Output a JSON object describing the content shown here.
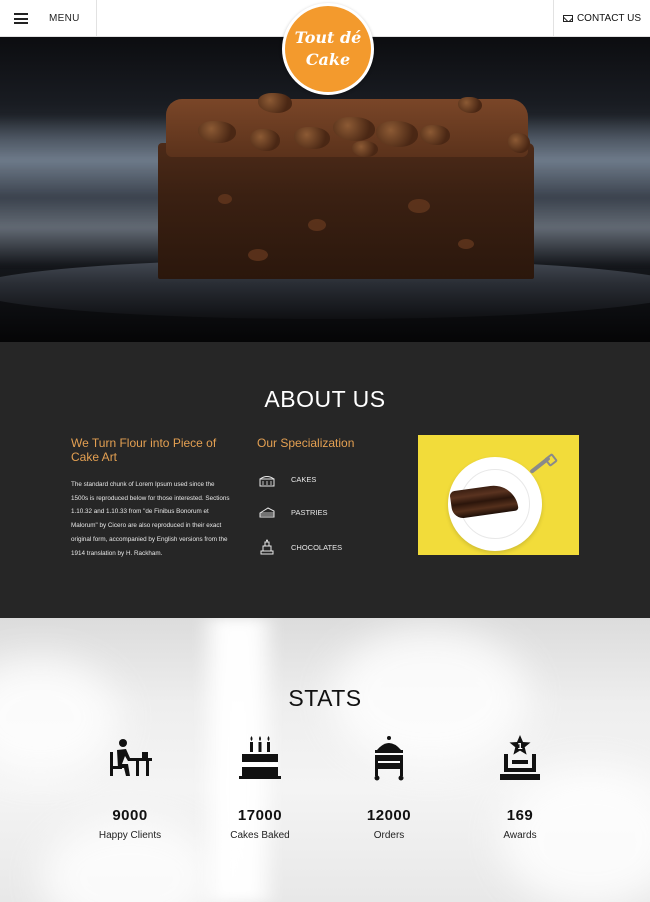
{
  "header": {
    "menu_label": "MENU",
    "contact_label": "CONTACT US",
    "logo_line1": "Tout dé",
    "logo_line2": "Cake",
    "logo_color": "#f39a2d"
  },
  "hero": {
    "image": "chocolate-walnut-brownie"
  },
  "about": {
    "title": "ABOUT US",
    "heading_left": "We Turn Flour into Piece of Cake Art",
    "text": "The standard chunk of Lorem Ipsum used since the 1500s is reproduced below for those interested. Sections 1.10.32 and 1.10.33 from \"de Finibus Bonorum et Malorum\" by Cicero are also reproduced in their exact original form, accompanied by English versions from the 1914 translation by H. Rackham.",
    "heading_middle": "Our Specialization",
    "specializations": [
      {
        "icon": "cake-icon",
        "label": "CAKES"
      },
      {
        "icon": "pastry-icon",
        "label": "PASTRIES"
      },
      {
        "icon": "chocolate-icon",
        "label": "CHOCOLATES"
      }
    ],
    "photo": "chocolate-cake-slice-on-plate",
    "accent_color": "#e4a052"
  },
  "stats": {
    "title": "STATS",
    "items": [
      {
        "icon": "happy-client-icon",
        "number": "9000",
        "label": "Happy Clients"
      },
      {
        "icon": "birthday-cake-icon",
        "number": "17000",
        "label": "Cakes Baked"
      },
      {
        "icon": "order-cart-icon",
        "number": "12000",
        "label": "Orders"
      },
      {
        "icon": "award-icon",
        "number": "169",
        "label": "Awards"
      }
    ]
  }
}
